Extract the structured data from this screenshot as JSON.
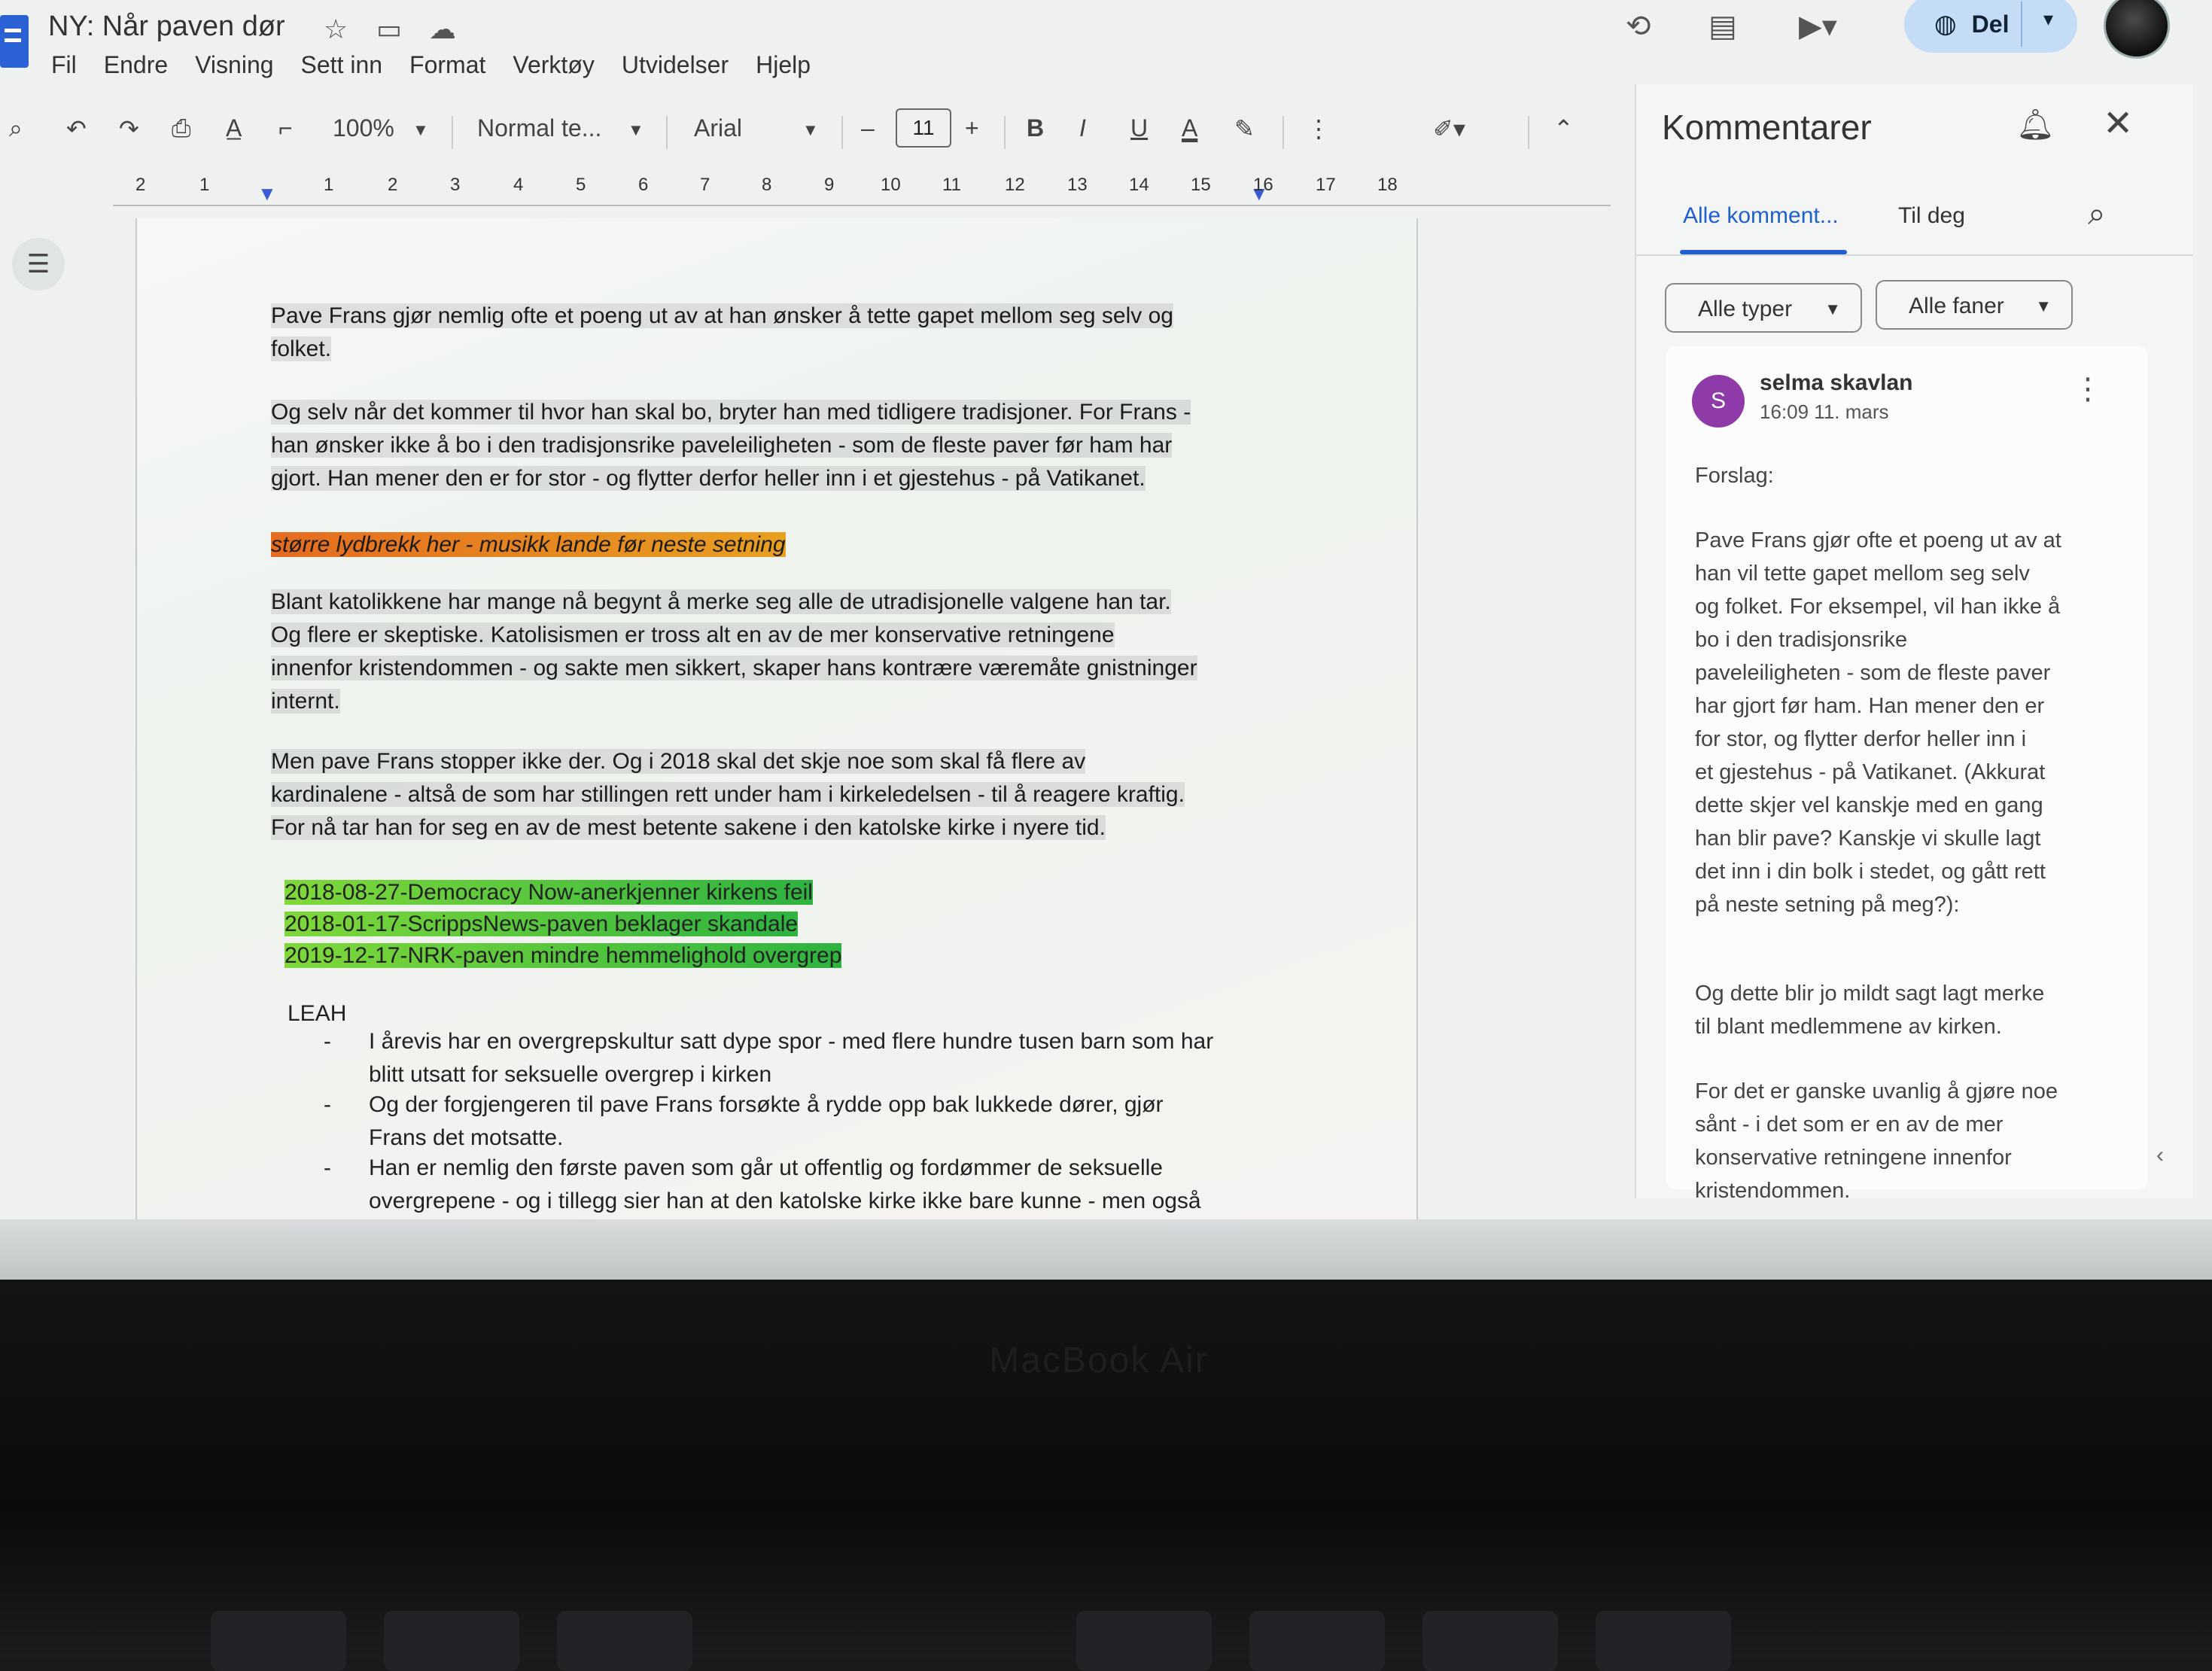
{
  "header": {
    "doc_title": "NY: Når paven dør",
    "menu": [
      "Fil",
      "Endre",
      "Visning",
      "Sett inn",
      "Format",
      "Verktøy",
      "Utvidelser",
      "Hjelp"
    ],
    "share_label": "Del"
  },
  "toolbar": {
    "zoom": "100%",
    "style": "Normal te...",
    "font": "Arial",
    "minus": "–",
    "font_size": "11",
    "plus": "+",
    "bold": "B",
    "italic": "I",
    "underline": "U",
    "text_color": "A"
  },
  "ruler": [
    "2",
    "1",
    "1",
    "2",
    "3",
    "4",
    "5",
    "6",
    "7",
    "8",
    "9",
    "10",
    "11",
    "12",
    "13",
    "14",
    "15",
    "16",
    "17",
    "18"
  ],
  "document": {
    "p1": [
      "Pave Frans gjør nemlig ofte et poeng ut av at han ønsker å tette gapet mellom seg selv og",
      "folket."
    ],
    "p2": [
      "Og selv når det kommer til hvor han skal bo, bryter han med tidligere tradisjoner. For Frans -",
      "han ønsker ikke å bo i den tradisjonsrike paveleiligheten - som de fleste paver før ham har",
      "gjort. Han mener den er for stor - og flytter derfor heller inn i et gjestehus - på Vatikanet."
    ],
    "note": "større lydbrekk her - musikk lande før neste setning",
    "p3": [
      "Blant katolikkene har mange nå begynt å merke seg alle de utradisjonelle valgene han tar.",
      "Og flere er skeptiske. Katolisismen er tross alt en av de mer konservative retningene",
      "innenfor kristendommen - og sakte men sikkert, skaper hans kontrære væremåte gnistninger",
      "internt."
    ],
    "p4": [
      "Men pave Frans stopper ikke der. Og i 2018 skal det skje noe som skal få flere av",
      "kardinalene - altså de som har stillingen rett under ham i kirkeledelsen - til å reagere kraftig.",
      "For nå tar han for seg en av de mest betente sakene i den katolske kirke i nyere tid."
    ],
    "links": [
      "2018-08-27-Democracy Now-anerkjenner kirkens feil",
      "2018-01-17-ScrippsNews-paven beklager skandale",
      "2019-12-17-NRK-paven mindre hemmelighold overgrep"
    ],
    "leah": "LEAH",
    "bullets": [
      [
        "I årevis har en overgrepskultur satt dype spor - med flere hundre tusen barn som har",
        "blitt utsatt for seksuelle overgrep i kirken"
      ],
      [
        "Og der forgjengeren til pave Frans forsøkte å rydde opp bak lukkede dører, gjør",
        "Frans det motsatte."
      ],
      [
        "Han er nemlig den første paven som går ut offentlig og fordømmer de seksuelle",
        "overgrepene - og i tillegg sier han at den katolske kirke ikke bare kunne - men også"
      ]
    ]
  },
  "comments": {
    "title": "Kommentarer",
    "tab_all": "Alle komment...",
    "tab_me": "Til deg",
    "filter_types": "Alle typer",
    "filter_tabs": "Alle faner",
    "author_initial": "S",
    "author": "selma skavlan",
    "time": "16:09 11. mars",
    "label": "Forslag:",
    "body1": [
      "Pave Frans gjør ofte et poeng ut av at",
      "han vil tette gapet mellom seg selv",
      "og folket. For eksempel, vil han ikke å",
      "bo i den tradisjonsrike",
      "paveleiligheten - som de fleste paver",
      "har gjort før ham. Han mener den er",
      "for stor, og flytter derfor heller inn i",
      "et gjestehus - på Vatikanet. (Akkurat",
      "dette skjer vel kanskje med en gang",
      "han blir pave? Kanskje vi skulle lagt",
      "det inn i din bolk i stedet, og gått rett",
      "på neste setning på meg?):"
    ],
    "body2": [
      "Og dette blir jo mildt sagt lagt merke",
      "til blant medlemmene av kirken."
    ],
    "body3": [
      "For det er ganske uvanlig å gjøre noe",
      "sånt - i det som er en av de mer",
      "konservative retningene innenfor",
      "kristendommen."
    ]
  },
  "device": {
    "label": "MacBook Air"
  },
  "icons": [
    "star-icon",
    "folder-icon",
    "cloud-icon",
    "history-icon",
    "comment-icon",
    "video-icon",
    "globe-icon",
    "search-icon",
    "undo-icon",
    "redo-icon",
    "print-icon",
    "spellcheck-icon",
    "paint-format-icon",
    "highlighter-icon",
    "more-icon",
    "pencil-icon",
    "collapse-icon",
    "bell-icon",
    "close-icon",
    "outline-icon"
  ],
  "colors": {
    "accent": "#1f5fd1",
    "share_bg": "#c5dcf6",
    "avatar_purple": "#8e3aa8",
    "note_orange": "#e56b1f",
    "link_green": "#2db33f"
  }
}
